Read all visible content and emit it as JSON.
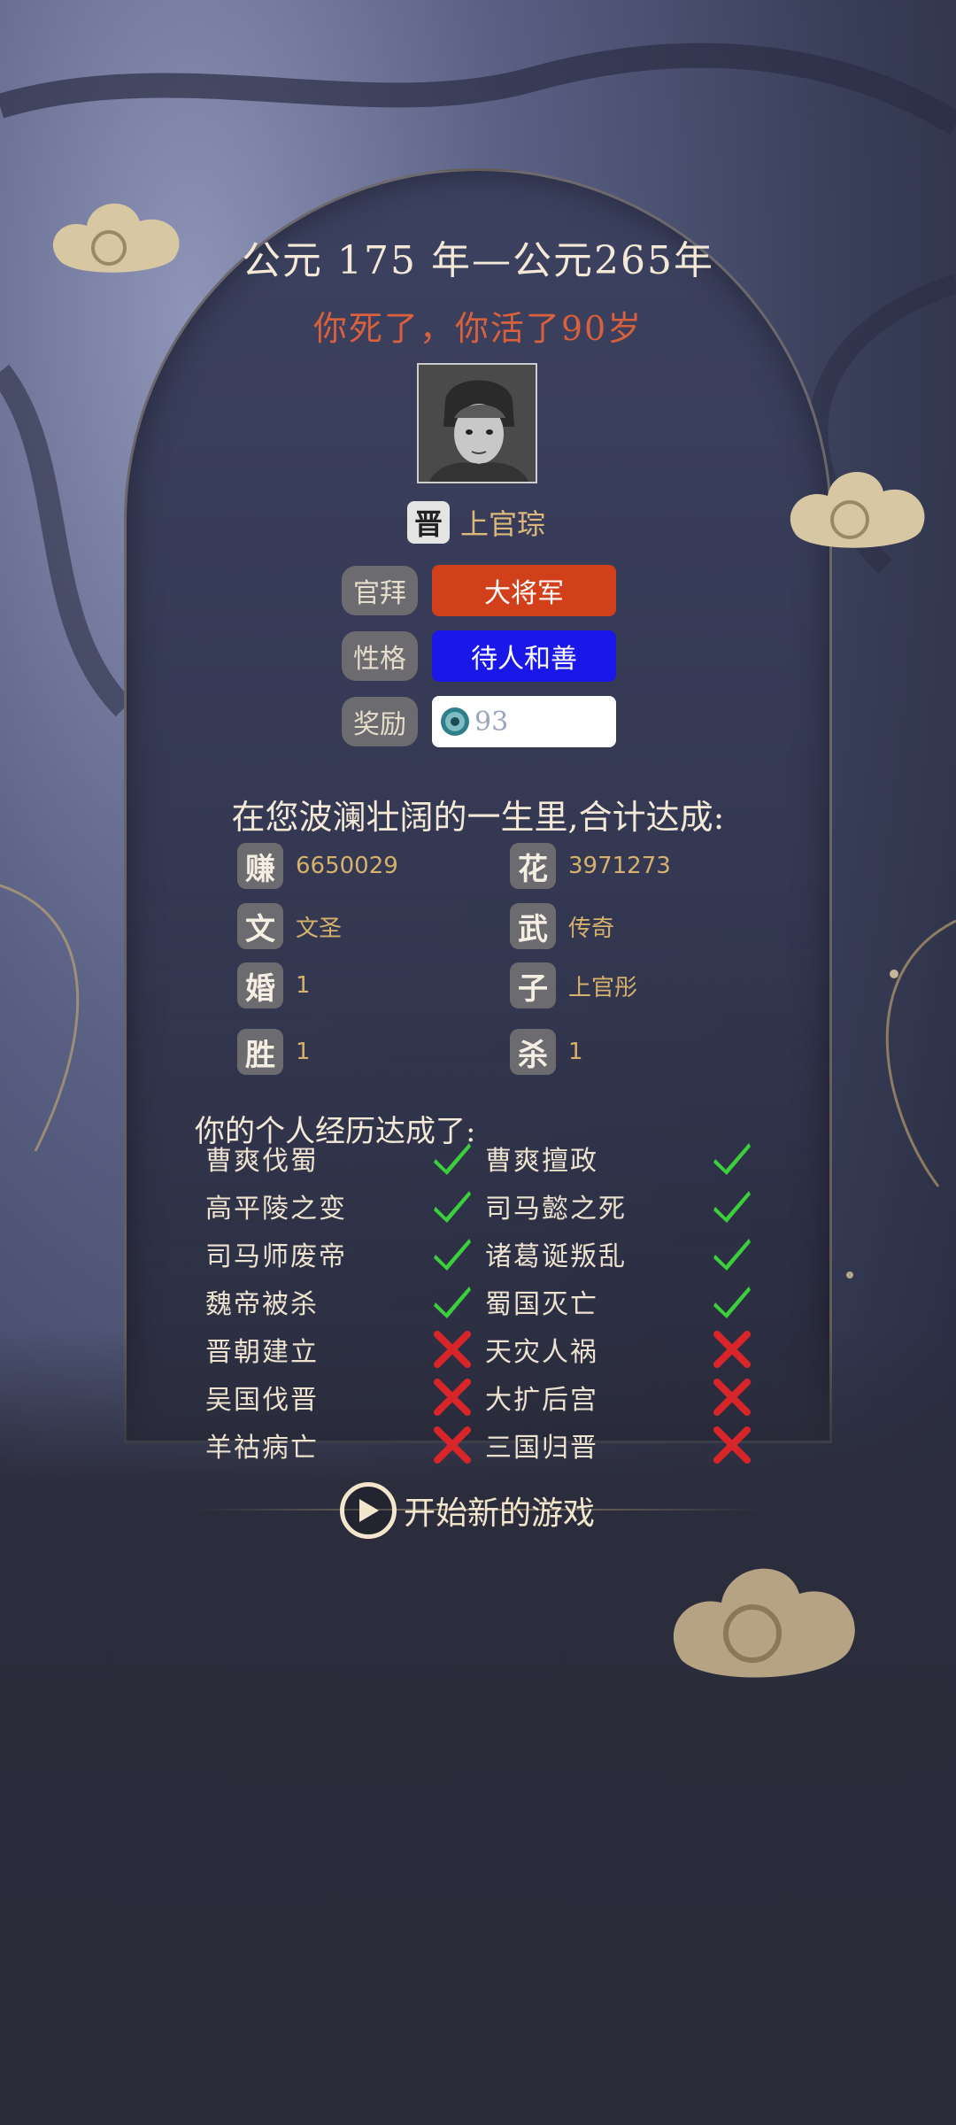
{
  "header": {
    "period": "公元 175 年—公元265年",
    "death_message": "你死了，你活了90岁"
  },
  "character": {
    "portrait_icon": "armored-warrior-portrait",
    "faction": "晋",
    "name": "上官琮"
  },
  "attributes": [
    {
      "label": "官拜",
      "value": "大将军",
      "color": "#d2401b"
    },
    {
      "label": "性格",
      "value": "待人和善",
      "color": "#1a18e8"
    },
    {
      "label": "奖励",
      "value": "93",
      "icon": "jade-coin-icon"
    }
  ],
  "summary": {
    "title": "在您波澜壮阔的一生里,合计达成:",
    "stats": [
      {
        "badge": "赚",
        "value": "6650029"
      },
      {
        "badge": "花",
        "value": "3971273"
      },
      {
        "badge": "文",
        "value": "文圣"
      },
      {
        "badge": "武",
        "value": "传奇"
      },
      {
        "badge": "婚",
        "value": "1"
      },
      {
        "badge": "子",
        "value": "上官彤"
      },
      {
        "badge": "胜",
        "value": "1"
      },
      {
        "badge": "杀",
        "value": "1"
      }
    ]
  },
  "experiences": {
    "title": "你的个人经历达成了:",
    "items": [
      {
        "label": "曹爽伐蜀",
        "done": true
      },
      {
        "label": "曹爽擅政",
        "done": true
      },
      {
        "label": "高平陵之变",
        "done": true
      },
      {
        "label": "司马懿之死",
        "done": true
      },
      {
        "label": "司马师废帝",
        "done": true
      },
      {
        "label": "诸葛诞叛乱",
        "done": true
      },
      {
        "label": "魏帝被杀",
        "done": true
      },
      {
        "label": "蜀国灭亡",
        "done": true
      },
      {
        "label": "晋朝建立",
        "done": false
      },
      {
        "label": "天灾人祸",
        "done": false
      },
      {
        "label": "吴国伐晋",
        "done": false
      },
      {
        "label": "大扩后宫",
        "done": false
      },
      {
        "label": "羊祜病亡",
        "done": false
      },
      {
        "label": "三国归晋",
        "done": false
      }
    ]
  },
  "actions": {
    "new_game": "开始新的游戏"
  },
  "colors": {
    "accent_gold": "#dcb97a",
    "death_red": "#d9603c",
    "check_green": "#3bcf3b",
    "cross_red": "#d8252a"
  }
}
